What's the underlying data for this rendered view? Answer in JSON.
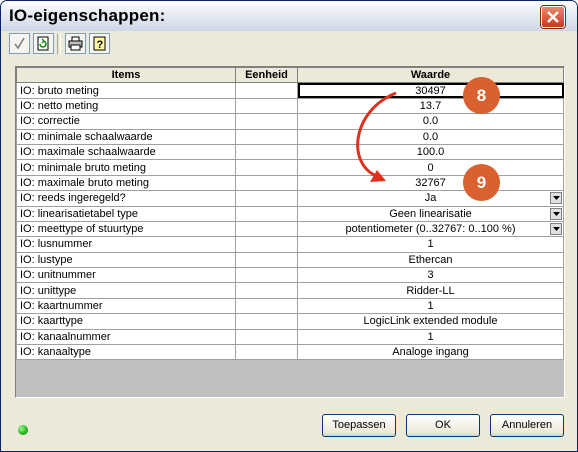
{
  "window": {
    "title": "IO-eigenschappen:"
  },
  "icons": {
    "close": "close-icon",
    "toolbar": [
      "checkmark-icon",
      "refresh-icon",
      "printer-icon",
      "help-icon"
    ]
  },
  "table": {
    "headers": {
      "items": "Items",
      "unit": "Eenheid",
      "value": "Waarde"
    },
    "rows": [
      {
        "item": "IO: bruto meting",
        "unit": "",
        "value": "30497",
        "dropdown": false
      },
      {
        "item": "IO: netto meting",
        "unit": "",
        "value": "13.7",
        "dropdown": false
      },
      {
        "item": "IO: correctie",
        "unit": "",
        "value": "0.0",
        "dropdown": false
      },
      {
        "item": "IO: minimale schaalwaarde",
        "unit": "",
        "value": "0.0",
        "dropdown": false
      },
      {
        "item": "IO: maximale schaalwaarde",
        "unit": "",
        "value": "100.0",
        "dropdown": false
      },
      {
        "item": "IO: minimale bruto meting",
        "unit": "",
        "value": "0",
        "dropdown": false
      },
      {
        "item": "IO: maximale bruto meting",
        "unit": "",
        "value": "32767",
        "dropdown": false
      },
      {
        "item": "IO: reeds ingeregeld?",
        "unit": "",
        "value": "Ja",
        "dropdown": true
      },
      {
        "item": "IO: linearisatietabel type",
        "unit": "",
        "value": "Geen linearisatie",
        "dropdown": true
      },
      {
        "item": "IO: meettype of stuurtype",
        "unit": "",
        "value": "potentiometer (0..32767: 0..100 %)",
        "dropdown": true
      },
      {
        "item": "IO: lusnummer",
        "unit": "",
        "value": "1",
        "dropdown": false
      },
      {
        "item": "IO: lustype",
        "unit": "",
        "value": "Ethercan",
        "dropdown": false
      },
      {
        "item": "IO: unitnummer",
        "unit": "",
        "value": "3",
        "dropdown": false
      },
      {
        "item": "IO: unittype",
        "unit": "",
        "value": "Ridder-LL",
        "dropdown": false
      },
      {
        "item": "IO: kaartnummer",
        "unit": "",
        "value": "1",
        "dropdown": false
      },
      {
        "item": "IO: kaarttype",
        "unit": "",
        "value": "LogicLink extended module",
        "dropdown": false
      },
      {
        "item": "IO: kanaalnummer",
        "unit": "",
        "value": "1",
        "dropdown": false
      },
      {
        "item": "IO: kanaaltype",
        "unit": "",
        "value": "Analoge ingang",
        "dropdown": false
      }
    ]
  },
  "annotations": {
    "badge_a": "8",
    "badge_b": "9",
    "badge_color": "#d9602f",
    "arrow_color": "#e0301e"
  },
  "status": {
    "light_color": "#1cb51c"
  },
  "buttons": {
    "apply": "Toepassen",
    "ok": "OK",
    "cancel": "Annuleren"
  }
}
